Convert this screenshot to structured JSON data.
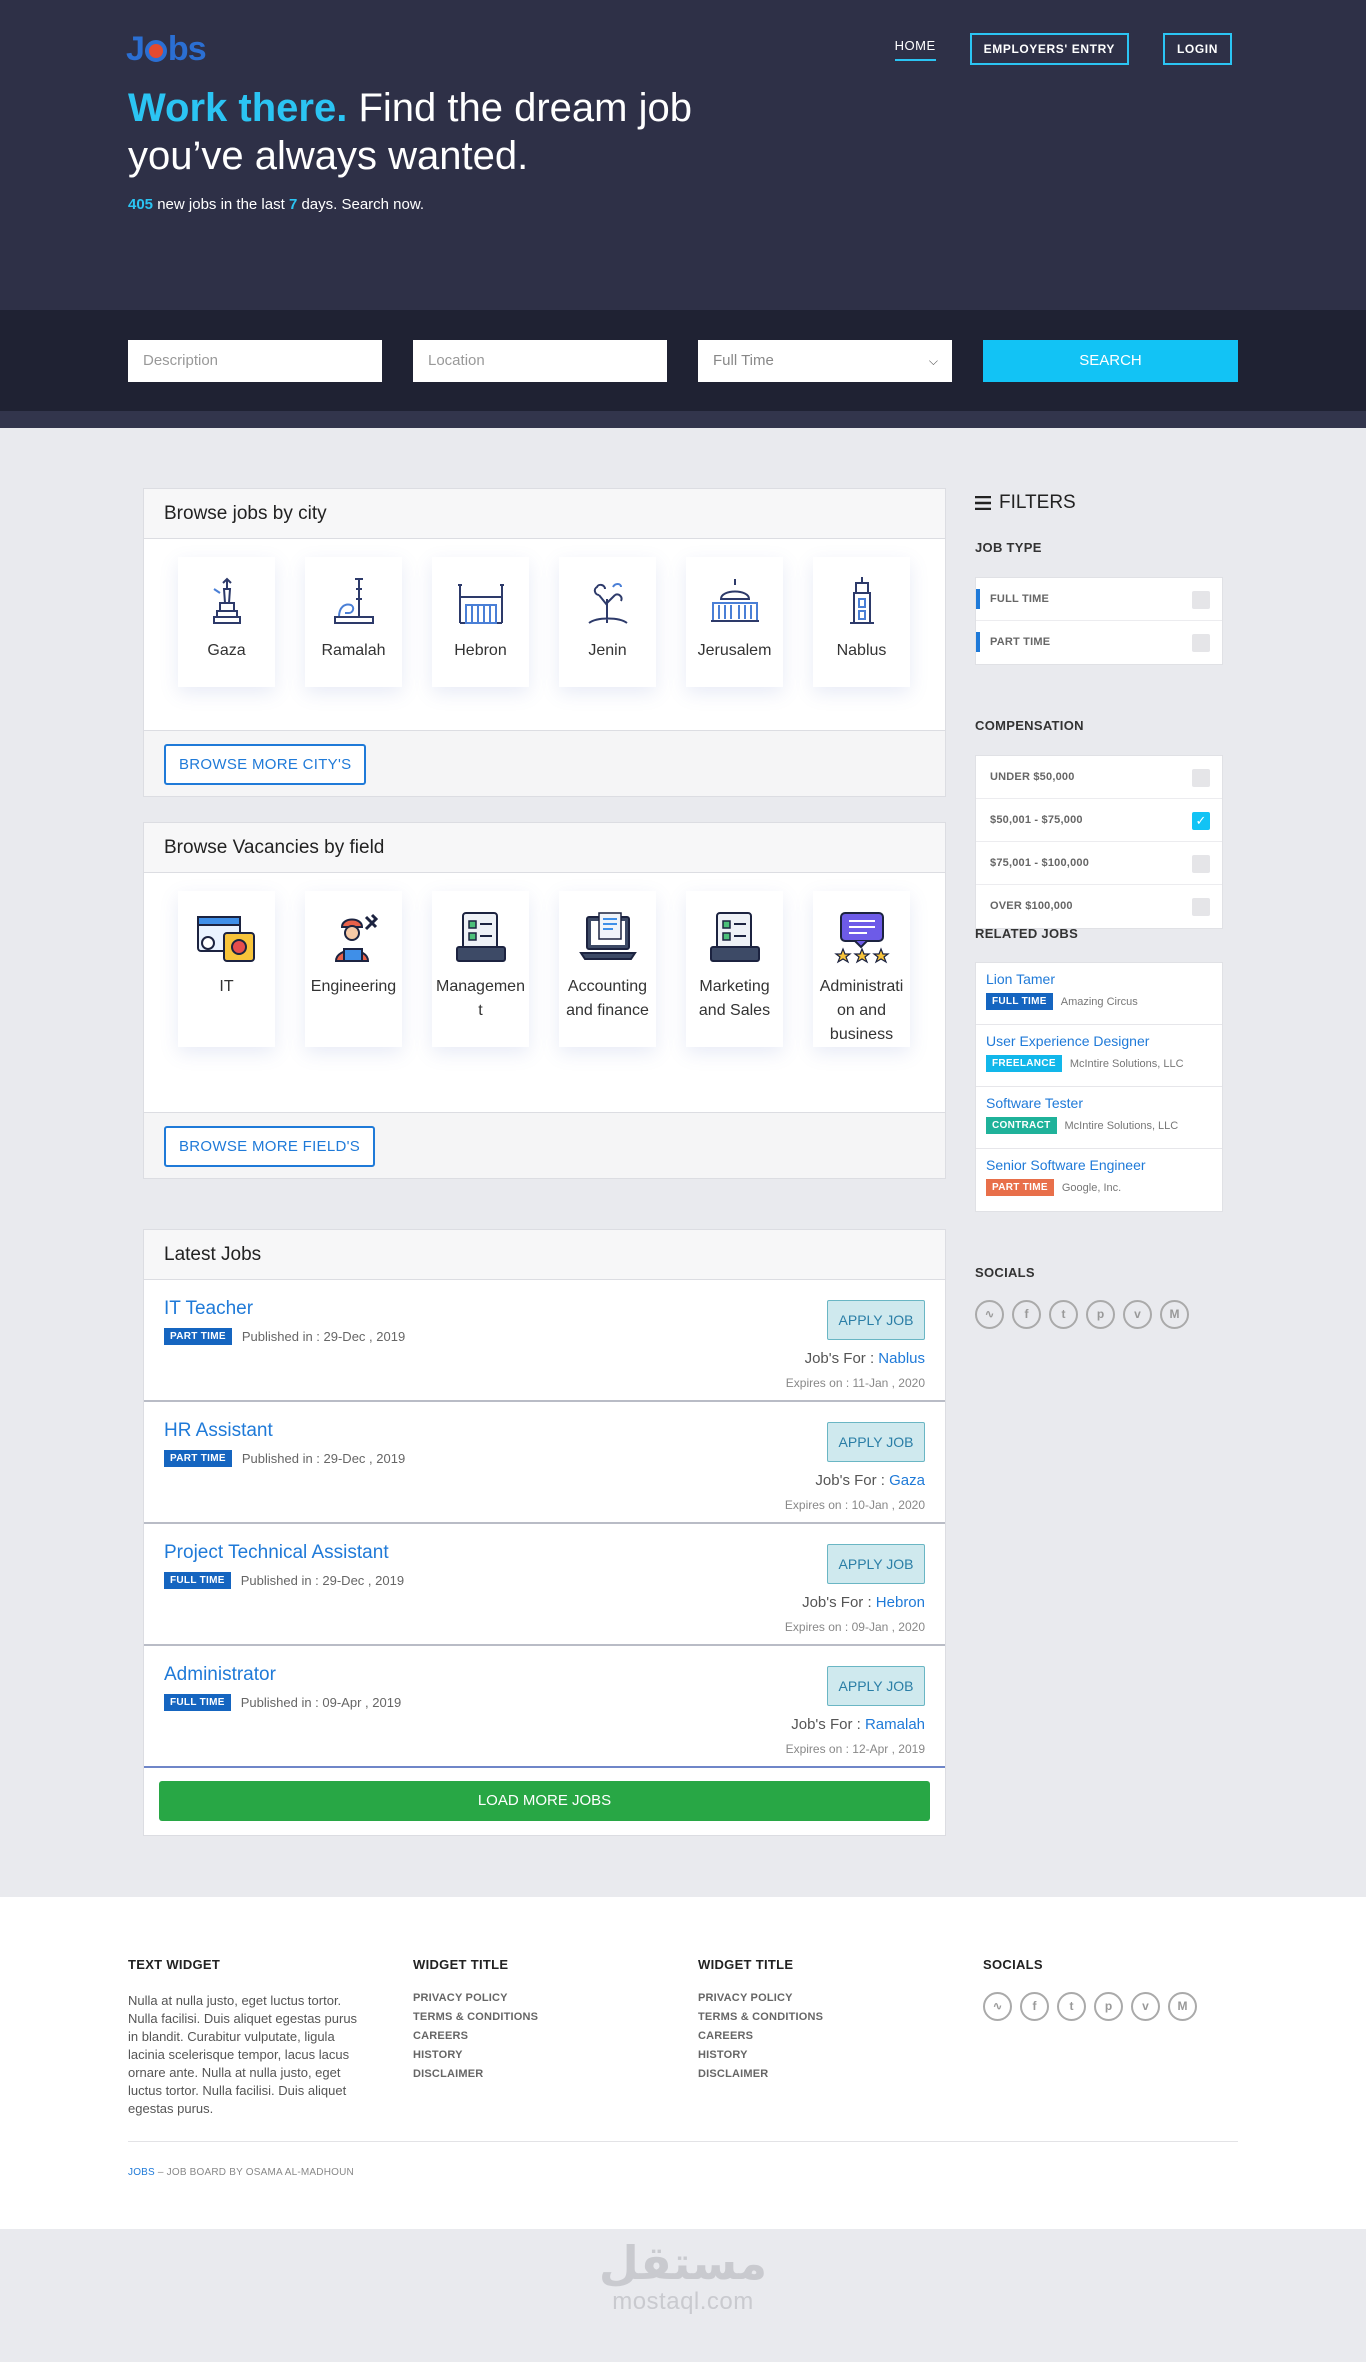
{
  "header": {
    "logo": "Jobs",
    "nav": {
      "home": "HOME",
      "employers": "EMPLOYERS' ENTRY",
      "login": "LOGIN"
    },
    "headline_accent": "Work there.",
    "headline_rest": "Find the dream job you’ve always wanted.",
    "sub": {
      "count": "405",
      "text1": "new jobs in the last",
      "days": "7",
      "text2": "days. Search now."
    }
  },
  "search": {
    "description_placeholder": "Description",
    "location_placeholder": "Location",
    "type_value": "Full Time",
    "button": "SEARCH"
  },
  "cities": {
    "title": "Browse jobs by city",
    "items": [
      {
        "label": "Gaza",
        "icon": "statue-icon"
      },
      {
        "label": "Ramalah",
        "icon": "lion-monument-icon"
      },
      {
        "label": "Hebron",
        "icon": "mosque-building-icon"
      },
      {
        "label": "Jenin",
        "icon": "tree-icon"
      },
      {
        "label": "Jerusalem",
        "icon": "dome-icon"
      },
      {
        "label": "Nablus",
        "icon": "tower-icon"
      }
    ],
    "more_button": "BROWSE MORE CITY'S"
  },
  "fields": {
    "title": "Browse Vacancies by field",
    "items": [
      {
        "label": "IT",
        "icon": "bug-window-icon"
      },
      {
        "label": "Engineering",
        "icon": "engineer-icon"
      },
      {
        "label": "Managemen t",
        "icon": "checklist-icon"
      },
      {
        "label": "Accounting and finance",
        "icon": "laptop-icon"
      },
      {
        "label": "Marketing and Sales",
        "icon": "checklist-icon"
      },
      {
        "label": "Administrati on and business",
        "icon": "rating-icon"
      }
    ],
    "more_button": "BROWSE MORE FIELD'S"
  },
  "latest": {
    "title": "Latest Jobs",
    "apply_label": "APPLY JOB",
    "for_label": "Job's For :",
    "jobs": [
      {
        "title": "IT Teacher",
        "type": "PART TIME",
        "published": "Published in : 29-Dec , 2019",
        "city": "Nablus",
        "expires": "Expires on : 11-Jan , 2020"
      },
      {
        "title": "HR Assistant",
        "type": "PART TIME",
        "published": "Published in : 29-Dec , 2019",
        "city": "Gaza",
        "expires": "Expires on : 10-Jan , 2020"
      },
      {
        "title": "Project Technical Assistant",
        "type": "FULL TIME",
        "published": "Published in : 29-Dec , 2019",
        "city": "Hebron",
        "expires": "Expires on : 09-Jan , 2020"
      },
      {
        "title": "Administrator",
        "type": "FULL TIME",
        "published": "Published in : 09-Apr , 2019",
        "city": "Ramalah",
        "expires": "Expires on : 12-Apr , 2019"
      }
    ],
    "load_more": "LOAD MORE JOBS"
  },
  "sidebar": {
    "filters_title": "FILTERS",
    "job_type_title": "JOB TYPE",
    "job_types": [
      {
        "label": "FULL TIME",
        "checked": false
      },
      {
        "label": "PART TIME",
        "checked": false
      }
    ],
    "compensation_title": "COMPENSATION",
    "compensation": [
      {
        "label": "UNDER $50,000",
        "checked": false
      },
      {
        "label": "$50,001 - $75,000",
        "checked": true
      },
      {
        "label": "$75,001 - $100,000",
        "checked": false
      },
      {
        "label": "OVER $100,000",
        "checked": false
      }
    ],
    "related_title": "RELATED JOBS",
    "related": [
      {
        "title": "Lion Tamer",
        "type": "FULL TIME",
        "company": "Amazing Circus",
        "color": "#1565c0"
      },
      {
        "title": "User Experience Designer",
        "type": "FREELANCE",
        "company": "McIntire Solutions, LLC",
        "color": "#12b7ea"
      },
      {
        "title": "Software Tester",
        "type": "CONTRACT",
        "company": "McIntire Solutions, LLC",
        "color": "#1fb29a"
      },
      {
        "title": "Senior Software Engineer",
        "type": "PART TIME",
        "company": "Google, Inc.",
        "color": "#e86f4a"
      }
    ],
    "socials_title": "SOCIALS",
    "socials": [
      "rss-icon",
      "facebook-icon",
      "twitter-icon",
      "pinterest-icon",
      "vimeo-icon",
      "medium-icon"
    ]
  },
  "footer": {
    "text_widget_title": "TEXT WIDGET",
    "text_widget_body": "Nulla at nulla justo, eget luctus tortor. Nulla facilisi. Duis aliquet egestas purus in blandit. Curabitur vulputate, ligula lacinia scelerisque tempor, lacus lacus ornare ante. Nulla at nulla justo, eget luctus tortor. Nulla facilisi. Duis aliquet egestas purus.",
    "widget1_title": "WIDGET TITLE",
    "widget2_title": "WIDGET TITLE",
    "links": [
      "PRIVACY POLICY",
      "TERMS & CONDITIONS",
      "CAREERS",
      "HISTORY",
      "DISCLAIMER"
    ],
    "socials_title": "SOCIALS",
    "credit_brand": "JOBS",
    "credit_rest": " – JOB BOARD BY OSAMA AL-MADHOUN"
  },
  "watermark": {
    "arabic": "مستقل",
    "latin": "mostaql.com"
  },
  "colors": {
    "accent": "#12c3f5",
    "link": "#1f7ad8",
    "hero_bg": "#2e3047",
    "success": "#28a745"
  }
}
